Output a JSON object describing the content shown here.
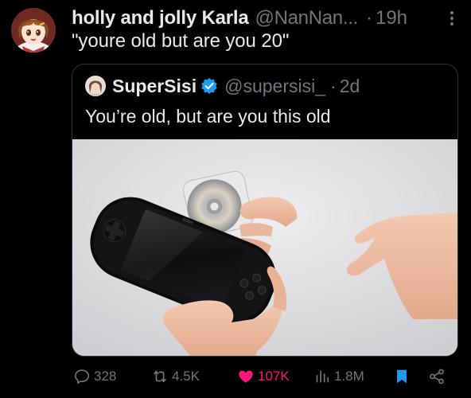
{
  "author": {
    "display_name": "holly and jolly Karla",
    "handle": "@NanNan...",
    "separator": "·",
    "time": "19h"
  },
  "tweet_text": "\"youre old but are you 20\"",
  "quote": {
    "display_name": "SuperSisi",
    "handle": "@supersisi_",
    "separator": "·",
    "time": "2d",
    "text": "You’re old, but are you this old"
  },
  "actions": {
    "replies": "328",
    "reposts": "4.5K",
    "likes": "107K",
    "views": "1.8M"
  },
  "colors": {
    "background": "#000000",
    "text_primary": "#e7e9ea",
    "text_secondary": "#71767b",
    "like_pink": "#f91880",
    "verified_blue": "#1d9bf0",
    "bookmark_blue": "#1d9bf0",
    "border": "#2f3336"
  },
  "icons": {
    "more": "more-icon",
    "verified": "verified-badge-icon",
    "reply": "reply-icon",
    "repost": "repost-icon",
    "like": "heart-icon",
    "views": "views-icon",
    "bookmark": "bookmark-icon",
    "share": "share-icon"
  }
}
